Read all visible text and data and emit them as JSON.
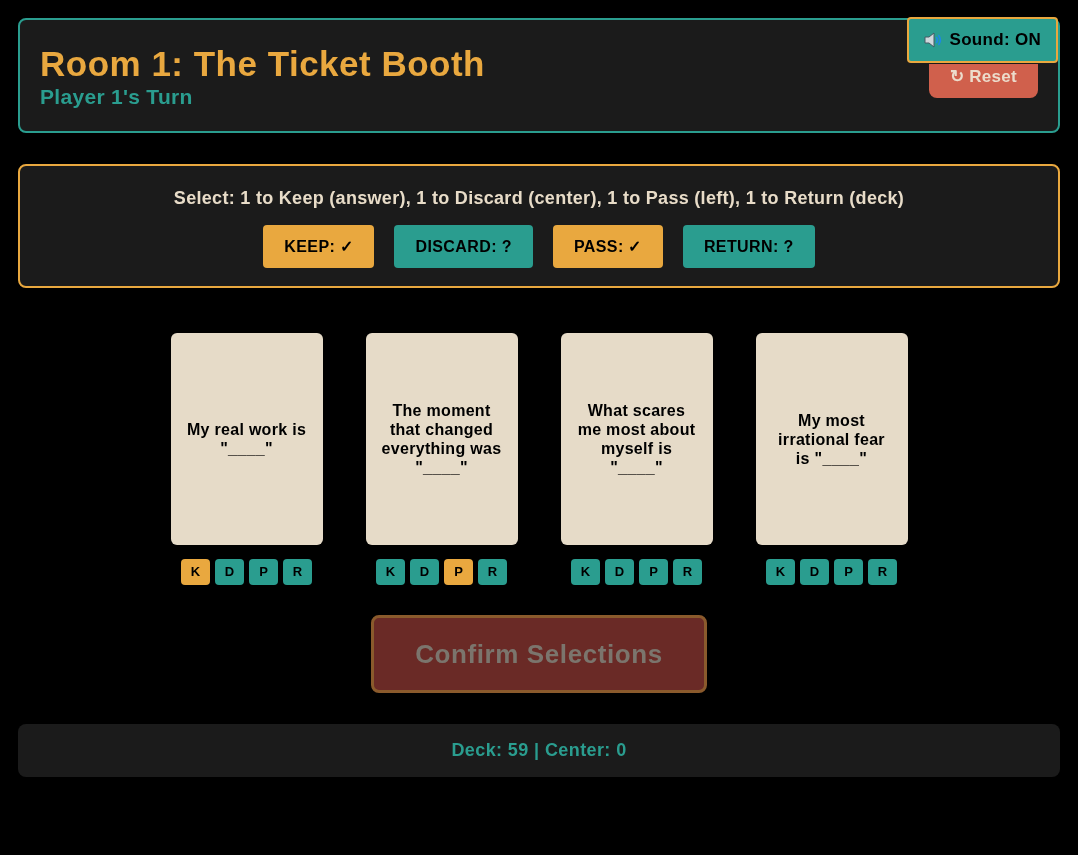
{
  "header": {
    "title": "Room 1: The Ticket Booth",
    "subtitle": "Player 1's Turn",
    "reset_button": "↻ Reset"
  },
  "sound_toggle": {
    "label": "Sound: ON",
    "on": true
  },
  "instructions": {
    "text": "Select: 1 to Keep (answer), 1 to Discard (center), 1 to Pass (left), 1 to Return (deck)",
    "statuses": [
      {
        "label": "KEEP: ✓",
        "done": true
      },
      {
        "label": "DISCARD: ?",
        "done": false
      },
      {
        "label": "PASS: ✓",
        "done": true
      },
      {
        "label": "RETURN: ?",
        "done": false
      }
    ]
  },
  "cards": [
    {
      "prompt": "My real work is \"____\"",
      "actions": [
        {
          "label": "K",
          "selected": true
        },
        {
          "label": "D",
          "selected": false
        },
        {
          "label": "P",
          "selected": false
        },
        {
          "label": "R",
          "selected": false
        }
      ]
    },
    {
      "prompt": "The moment that changed everything was \"____\"",
      "actions": [
        {
          "label": "K",
          "selected": false
        },
        {
          "label": "D",
          "selected": false
        },
        {
          "label": "P",
          "selected": true
        },
        {
          "label": "R",
          "selected": false
        }
      ]
    },
    {
      "prompt": "What scares me most about myself is \"____\"",
      "actions": [
        {
          "label": "K",
          "selected": false
        },
        {
          "label": "D",
          "selected": false
        },
        {
          "label": "P",
          "selected": false
        },
        {
          "label": "R",
          "selected": false
        }
      ]
    },
    {
      "prompt": "My most irrational fear is \"____\"",
      "actions": [
        {
          "label": "K",
          "selected": false
        },
        {
          "label": "D",
          "selected": false
        },
        {
          "label": "P",
          "selected": false
        },
        {
          "label": "R",
          "selected": false
        }
      ]
    }
  ],
  "confirm_button": {
    "label": "Confirm Selections",
    "disabled": true
  },
  "footer": {
    "text": "Deck: 59 | Center: 0"
  }
}
